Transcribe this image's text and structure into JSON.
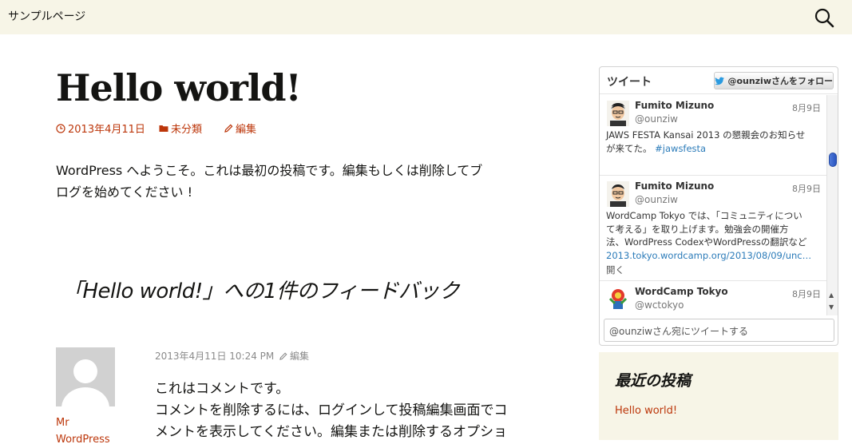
{
  "nav": {
    "page_link": "サンプルページ"
  },
  "post": {
    "title": "Hello world!",
    "date": "2013年4月11日",
    "category": "未分類",
    "edit": "編集",
    "body_line1": "WordPress へようこそ。これは最初の投稿です。編集もしくは削除してブ",
    "body_line2": "ログを始めてください !"
  },
  "comments": {
    "title": "「Hello world!」への1件のフィードバック",
    "items": [
      {
        "author_line1": "Mr",
        "author_line2": "WordPress",
        "date": "2013年4月11日 10:24 PM",
        "edit": "編集",
        "line1": "これはコメントです。",
        "line2": "コメントを削除するには、ログインして投稿編集画面でコ",
        "line3": "メントを表示してください。編集または削除するオプショ"
      }
    ]
  },
  "twitter": {
    "title": "ツイート",
    "follow_label": "@ounziwさんをフォロー",
    "compose_placeholder": "@ounziwさん宛にツイートする",
    "tweets": [
      {
        "name": "Fumito Mizuno",
        "handle": "@ounziw",
        "time": "8月9日",
        "line1": "JAWS FESTA Kansai 2013 の懇親会のお知らせ",
        "line2_text": "が来てた。",
        "line2_tag": "#jawsfesta"
      },
      {
        "name": "Fumito Mizuno",
        "handle": "@ounziw",
        "time": "8月9日",
        "line1": "WordCamp Tokyo では、「コミュニティについ",
        "line2": "て考える」を取り上げます。勉強会の開催方",
        "line3": "法、WordPress CodexやWordPressの翻訳など",
        "link": "2013.tokyo.wordcamp.org/2013/08/09/unc…",
        "open": "開く"
      },
      {
        "name": "WordCamp Tokyo",
        "handle": "@wctokyo",
        "time": "8月9日"
      }
    ]
  },
  "recent": {
    "title": "最近の投稿",
    "items": [
      "Hello world!"
    ]
  },
  "colors": {
    "accent": "#bc360a",
    "bar_bg": "#f7f5e7",
    "twitter_blue": "#2b7bb9"
  },
  "icons": [
    "search-icon",
    "clock-icon",
    "folder-icon",
    "pencil-icon",
    "twitter-bird-icon"
  ]
}
